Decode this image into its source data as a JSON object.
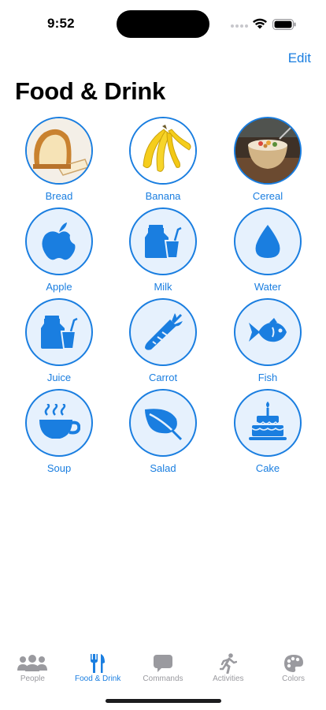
{
  "status": {
    "time": "9:52"
  },
  "header": {
    "edit_label": "Edit",
    "title": "Food & Drink"
  },
  "items": [
    {
      "label": "Bread",
      "icon": "bread-photo"
    },
    {
      "label": "Banana",
      "icon": "banana-photo"
    },
    {
      "label": "Cereal",
      "icon": "cereal-photo"
    },
    {
      "label": "Apple",
      "icon": "apple-icon"
    },
    {
      "label": "Milk",
      "icon": "milk-icon"
    },
    {
      "label": "Water",
      "icon": "water-drop-icon"
    },
    {
      "label": "Juice",
      "icon": "juice-icon"
    },
    {
      "label": "Carrot",
      "icon": "carrot-icon"
    },
    {
      "label": "Fish",
      "icon": "fish-icon"
    },
    {
      "label": "Soup",
      "icon": "soup-icon"
    },
    {
      "label": "Salad",
      "icon": "leaf-icon"
    },
    {
      "label": "Cake",
      "icon": "cake-icon"
    }
  ],
  "tabs": [
    {
      "label": "People",
      "icon": "people-icon",
      "active": false
    },
    {
      "label": "Food & Drink",
      "icon": "fork-knife-icon",
      "active": true
    },
    {
      "label": "Commands",
      "icon": "speech-bubble-icon",
      "active": false
    },
    {
      "label": "Activities",
      "icon": "running-figure-icon",
      "active": false
    },
    {
      "label": "Colors",
      "icon": "palette-icon",
      "active": false
    }
  ],
  "colors": {
    "accent": "#1a7ee0",
    "tile_fill": "#e6f1fd",
    "tab_inactive": "#9a9a9f"
  }
}
